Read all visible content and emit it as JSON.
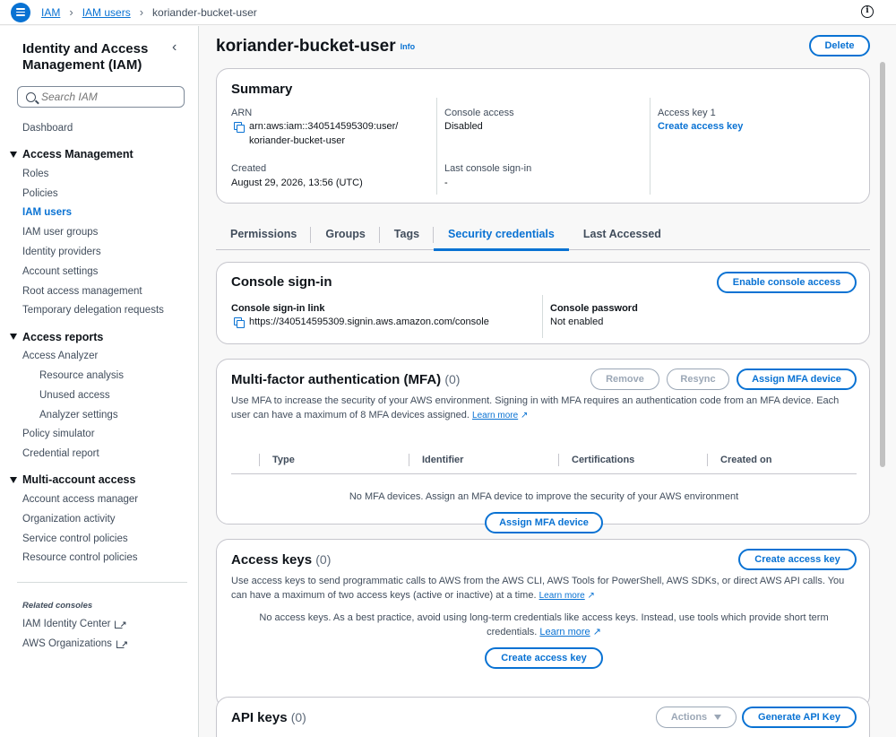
{
  "breadcrumb": {
    "root": "IAM",
    "section": "IAM users",
    "current": "koriander-bucket-user"
  },
  "sidebar": {
    "title": "Identity and Access Management (IAM)",
    "search_placeholder": "Search IAM",
    "dashboard": "Dashboard",
    "sections": [
      {
        "label": "Access Management",
        "items": [
          "Roles",
          "Policies",
          "IAM users",
          "IAM user groups",
          "Identity providers",
          "Account settings",
          "Root access management",
          "Temporary delegation requests"
        ]
      },
      {
        "label": "Access reports",
        "items": [
          "Access Analyzer",
          "Resource analysis",
          "Unused access",
          "Analyzer settings",
          "Policy simulator",
          "Credential report"
        ]
      },
      {
        "label": "Multi-account access",
        "items": [
          "Account access manager",
          "Organization activity",
          "Service control policies",
          "Resource control policies"
        ]
      }
    ],
    "related_title": "Related consoles",
    "related": [
      "IAM Identity Center",
      "AWS Organizations"
    ]
  },
  "page": {
    "title": "koriander-bucket-user",
    "info": "Info",
    "delete_label": "Delete"
  },
  "summary": {
    "title": "Summary",
    "arn_label": "ARN",
    "arn_line1": "arn:aws:iam::340514595309:user/",
    "arn_line2": "koriander-bucket-user",
    "created_label": "Created",
    "created_value": "August 29, 2026, 13:56 (UTC)",
    "console_access_label": "Console access",
    "console_access_value": "Disabled",
    "last_signin_label": "Last console sign-in",
    "last_signin_value": "-",
    "access_key_label": "Access key 1",
    "create_access_key": "Create access key"
  },
  "tabs": [
    "Permissions",
    "Groups",
    "Tags",
    "Security credentials",
    "Last Accessed"
  ],
  "console_signin": {
    "title": "Console sign-in",
    "enable_label": "Enable console access",
    "link_label": "Console sign-in link",
    "link_value": "https://340514595309.signin.aws.amazon.com/console",
    "password_label": "Console password",
    "password_value": "Not enabled"
  },
  "mfa": {
    "title": "Multi-factor authentication (MFA)",
    "count": "(0)",
    "remove": "Remove",
    "resync": "Resync",
    "assign": "Assign MFA device",
    "description": "Use MFA to increase the security of your AWS environment. Signing in with MFA requires an authentication code from an MFA device. Each user can have a maximum of 8 MFA devices assigned.",
    "learn_more": "Learn more",
    "columns": [
      "Type",
      "Identifier",
      "Certifications",
      "Created on"
    ],
    "empty": "No MFA devices. Assign an MFA device to improve the security of your AWS environment",
    "assign_center": "Assign MFA device"
  },
  "access_keys": {
    "title": "Access keys",
    "count": "(0)",
    "create": "Create access key",
    "description": "Use access keys to send programmatic calls to AWS from the AWS CLI, AWS Tools for PowerShell, AWS SDKs, or direct AWS API calls. You can have a maximum of two access keys (active or inactive) at a time.",
    "learn_more": "Learn more",
    "empty_line1": "No access keys. As a best practice, avoid using long-term credentials like access keys. Instead, use tools which provide short term",
    "empty_line2": "credentials.",
    "empty_learn_more": "Learn more",
    "create_center": "Create access key"
  },
  "api_keys": {
    "title": "API keys",
    "count": "(0)",
    "actions": "Actions",
    "generate": "Generate API Key"
  },
  "colors": {
    "accent": "#0972d3",
    "text": "#0f141a",
    "muted": "#414d5c",
    "disabled": "#9ba7b6"
  }
}
